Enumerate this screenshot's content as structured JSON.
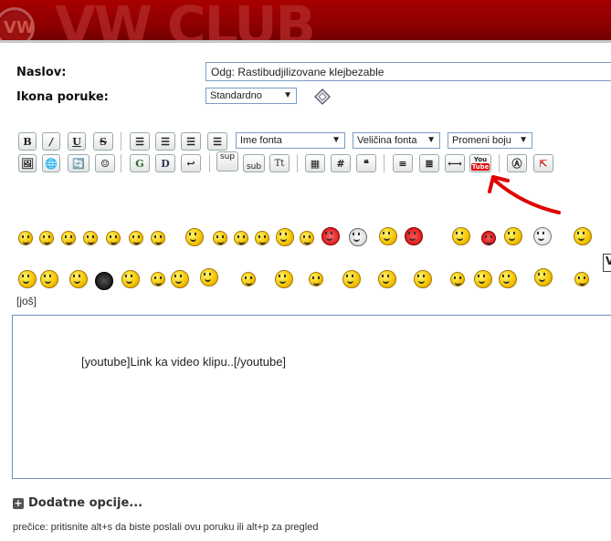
{
  "banner": {
    "logo_text": "VW",
    "watermark": "VW CLUB"
  },
  "form": {
    "title_label": "Naslov:",
    "title_value": "Odg: Rastibudjilizovane klejbezable",
    "icon_label": "Ikona poruke:",
    "icon_value": "Standardno"
  },
  "toolbar": {
    "font_name": "Ime fonta",
    "font_size": "Veličina fonta",
    "font_color": "Promeni boju",
    "bold": "B",
    "sup": "sup",
    "sub": "sub",
    "tt": "Tt",
    "hash": "#",
    "youtube_top": "You",
    "youtube_bottom": "Tube"
  },
  "smilies": {
    "more_link": "[još]"
  },
  "editor": {
    "content": "[youtube]Link ka video klipu..[/youtube]"
  },
  "footer": {
    "more_options": "Dodatne opcije...",
    "hint": "prečice: pritisnite alt+s da biste poslali ovu poruku ili alt+p za pregled"
  },
  "colors": {
    "banner": "#8a0000",
    "input_border": "#7a9cc7",
    "arrow": "#e00000"
  }
}
